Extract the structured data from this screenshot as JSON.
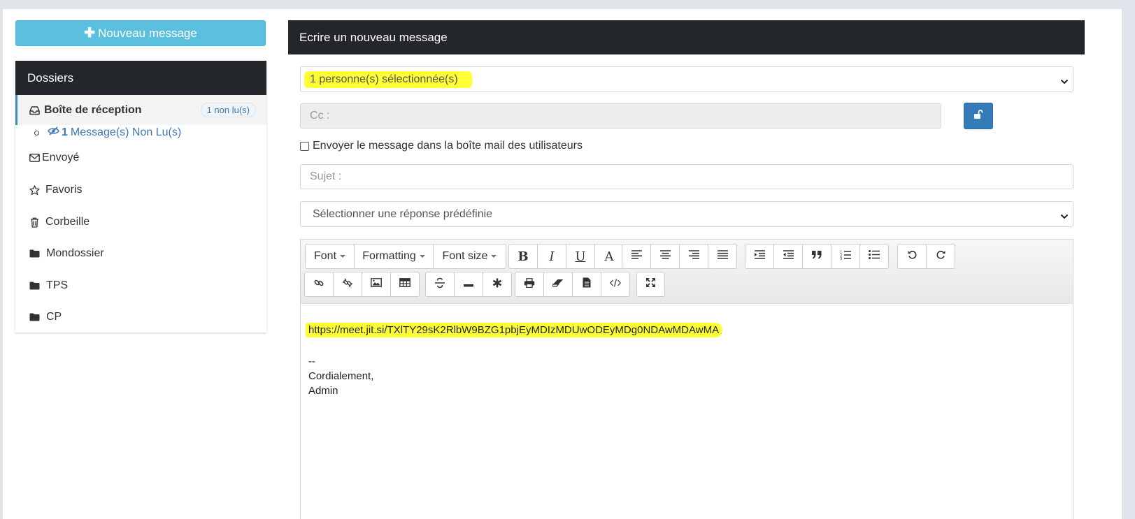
{
  "sidebar": {
    "new_message_label": "Nouveau message",
    "folders_title": "Dossiers",
    "inbox": {
      "label": "Boîte de réception",
      "badge": "1 non lu(s)"
    },
    "unread": {
      "count": "1",
      "label": "Message(s) Non Lu(s)"
    },
    "items": [
      {
        "label": "Envoyé",
        "icon": "envelope-icon"
      },
      {
        "label": "Favoris",
        "icon": "star-icon"
      },
      {
        "label": "Corbeille",
        "icon": "trash-icon"
      },
      {
        "label": "Mondossier",
        "icon": "folder-icon"
      },
      {
        "label": "TPS",
        "icon": "folder-icon"
      },
      {
        "label": "CP",
        "icon": "folder-icon"
      }
    ]
  },
  "composer": {
    "title": "Ecrire un nouveau message",
    "recipients_value": "1 personne(s) sélectionnée(s)",
    "cc_placeholder": "Cc :",
    "send_mail_label": "Envoyer le message dans la boîte mail des utilisateurs",
    "subject_placeholder": "Sujet :",
    "predefined_value": "Sélectionner une réponse prédéfinie",
    "toolbar": {
      "font": "Font",
      "formatting": "Formatting",
      "font_size": "Font size",
      "bold": "B",
      "italic": "I",
      "underline": "U",
      "text_color": "A"
    },
    "body": {
      "link": "https://meet.jit.si/TXlTY29sK2RlbW9BZG1pbjEyMDIzMDUwODEyMDg0NDAwMDAwMA",
      "separator": "--",
      "closing": "Cordialement,",
      "signature": "Admin"
    }
  },
  "colors": {
    "header_dark": "#23272b",
    "new_button": "#5bc0de",
    "primary": "#337ab7",
    "highlight": "#ffff33",
    "link": "#3c78b4"
  }
}
